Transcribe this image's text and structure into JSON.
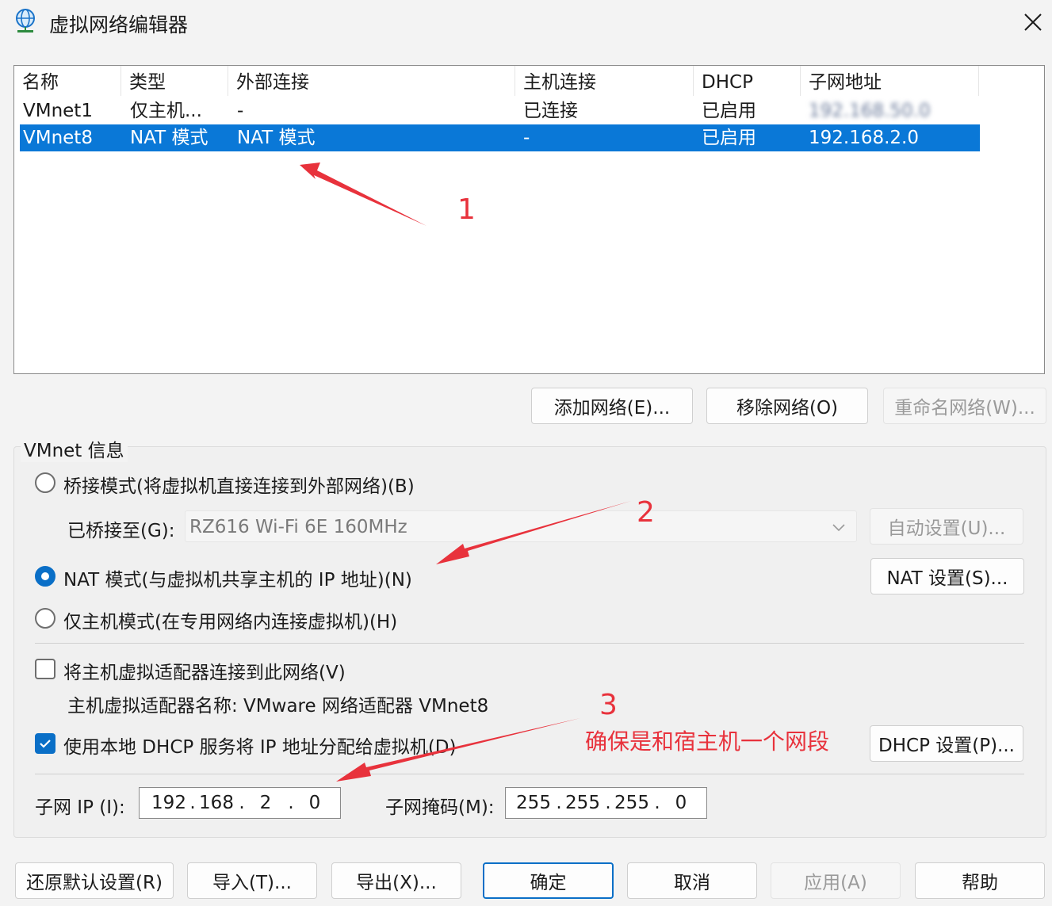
{
  "window": {
    "title": "虚拟网络编辑器",
    "icon": "globe-network-icon"
  },
  "list": {
    "columns": [
      "名称",
      "类型",
      "外部连接",
      "主机连接",
      "DHCP",
      "子网地址"
    ],
    "rows": [
      {
        "name": "VMnet1",
        "type": "仅主机...",
        "external": "-",
        "host": "已连接",
        "dhcp": "已启用",
        "subnet": "192.168.50.0",
        "selected": false
      },
      {
        "name": "VMnet8",
        "type": "NAT 模式",
        "external": "NAT 模式",
        "host": "-",
        "dhcp": "已启用",
        "subnet": "192.168.2.0",
        "selected": true
      }
    ]
  },
  "list_buttons": {
    "add": "添加网络(E)...",
    "remove": "移除网络(O)",
    "rename": "重命名网络(W)..."
  },
  "vmnet_info": {
    "title": "VMnet 信息",
    "bridge_mode": "桥接模式(将虚拟机直接连接到外部网络)(B)",
    "bridged_to_label": "已桥接至(G):",
    "bridged_to_value": "RZ616 Wi-Fi 6E 160MHz",
    "auto_settings": "自动设置(U)...",
    "nat_mode": "NAT 模式(与虚拟机共享主机的 IP 地址)(N)",
    "nat_settings": "NAT 设置(S)...",
    "host_only_mode": "仅主机模式(在专用网络内连接虚拟机)(H)",
    "selected_mode": "nat",
    "connect_host_adapter": "将主机虚拟适配器连接到此网络(V)",
    "connect_host_adapter_checked": false,
    "host_adapter_name": "主机虚拟适配器名称: VMware 网络适配器 VMnet8",
    "use_dhcp": "使用本地 DHCP 服务将 IP 地址分配给虚拟机(D)",
    "use_dhcp_checked": true,
    "dhcp_settings": "DHCP 设置(P)...",
    "subnet_ip_label": "子网 IP (I):",
    "subnet_ip": [
      "192",
      "168",
      "2",
      "0"
    ],
    "subnet_mask_label": "子网掩码(M):",
    "subnet_mask": [
      "255",
      "255",
      "255",
      "0"
    ]
  },
  "bottom_buttons": {
    "restore": "还原默认设置(R)",
    "import": "导入(T)...",
    "export": "导出(X)...",
    "ok": "确定",
    "cancel": "取消",
    "apply": "应用(A)",
    "help": "帮助"
  },
  "annotations": {
    "n1": "1",
    "n2": "2",
    "n3": "3",
    "note": "确保是和宿主机一个网段",
    "color": "#e8323c"
  },
  "colors": {
    "selection": "#0a78d7",
    "accent": "#0a6fc7"
  }
}
